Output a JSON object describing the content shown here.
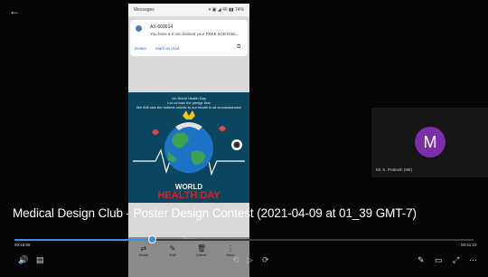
{
  "player": {
    "title": "Medical Design Club - Poster Design Contest (2021-04-09 at 01_39 GMT-7)",
    "time_current": "00:16:59",
    "time_total": "00:41:10",
    "progress_fraction": 0.3,
    "accent_color": "#3f8de0"
  },
  "shared_screen": {
    "status_app": "Messages",
    "status_icons": "▾ ▣ ◢ 46 ▮▮ 74%",
    "notification": {
      "sender": "AX-660014",
      "message": "You have a 0 not claimed your FREE 5GB Data...",
      "action_delete": "Delete",
      "action_mark": "Mark as read",
      "copy_icon": "copy-icon"
    },
    "poster": {
      "line1": "On World Health Day",
      "line2": "Let us take the pledge that",
      "line3": "We Will give the highest priority to our health in all circumstances!",
      "world": "WORLD",
      "health_day": "HEALTH DAY"
    },
    "nav": {
      "watermark": "Share",
      "share": "Share",
      "edit": "Edit",
      "delete": "Delete",
      "more": "More"
    }
  },
  "participant": {
    "initial": "M",
    "name": "Mr. K. Prakash (IMI)",
    "avatar_color": "#7a2fa8"
  },
  "icons": {
    "back": "back-arrow-icon",
    "volume": "volume-icon",
    "captions": "captions-icon",
    "pen": "pen-icon",
    "screen": "screen-icon",
    "fullscreen": "fullscreen-icon",
    "more": "more-icon"
  }
}
